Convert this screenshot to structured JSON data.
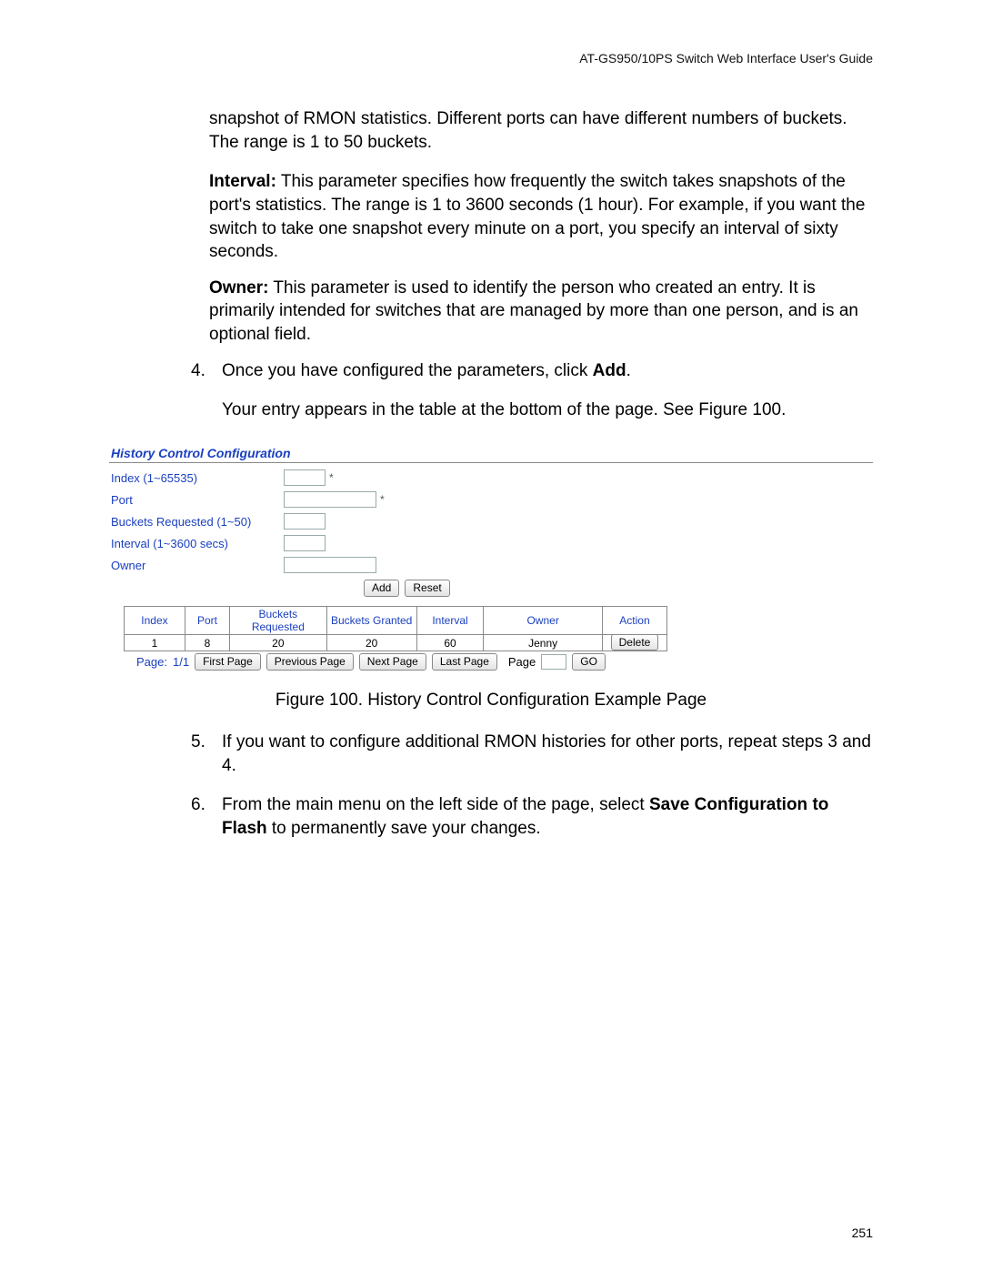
{
  "header": {
    "running_head": "AT-GS950/10PS Switch Web Interface User's Guide"
  },
  "intro": {
    "snapshot_line": "snapshot of RMON statistics. Different ports can have different numbers of buckets. The range is 1 to 50 buckets.",
    "interval_label": "Interval:",
    "interval_text": " This parameter specifies how frequently the switch takes snapshots of the port's statistics. The range is 1 to 3600 seconds (1 hour). For example, if you want the switch to take one snapshot every minute on a port, you specify an interval of sixty seconds.",
    "owner_label": "Owner:",
    "owner_text": " This parameter is used to identify the person who created an entry. It is primarily intended for switches that are managed by more than one person, and is an optional field."
  },
  "step4": {
    "num": "4.",
    "line1_before": "Once you have configured the parameters, click ",
    "line1_bold": "Add",
    "line1_after": ".",
    "line2": "Your entry appears in the table at the bottom of the page. See Figure 100."
  },
  "ui": {
    "title": "History Control Configuration",
    "labels": {
      "index": "Index (1~65535)",
      "port": "Port",
      "buckets": "Buckets Requested (1~50)",
      "interval": "Interval (1~3600 secs)",
      "owner": "Owner"
    },
    "buttons": {
      "add": "Add",
      "reset": "Reset",
      "delete": "Delete",
      "go": "GO",
      "first": "First Page",
      "prev": "Previous Page",
      "next": "Next Page",
      "last": "Last Page"
    },
    "table": {
      "headers": [
        "Index",
        "Port",
        "Buckets Requested",
        "Buckets Granted",
        "Interval",
        "Owner",
        "Action"
      ],
      "row": {
        "index": "1",
        "port": "8",
        "req": "20",
        "granted": "20",
        "interval": "60",
        "owner": "Jenny"
      }
    },
    "pager": {
      "page_label": "Page:",
      "page_value": "1/1",
      "page_word": "Page"
    }
  },
  "caption": "Figure 100. History Control Configuration Example Page",
  "step5": {
    "num": "5.",
    "text": "If you want to configure additional RMON histories for other ports, repeat steps 3 and 4."
  },
  "step6": {
    "num": "6.",
    "before": "From the main menu on the left side of the page, select ",
    "bold": "Save Configuration to Flash",
    "after": " to permanently save your changes."
  },
  "page_number": "251"
}
